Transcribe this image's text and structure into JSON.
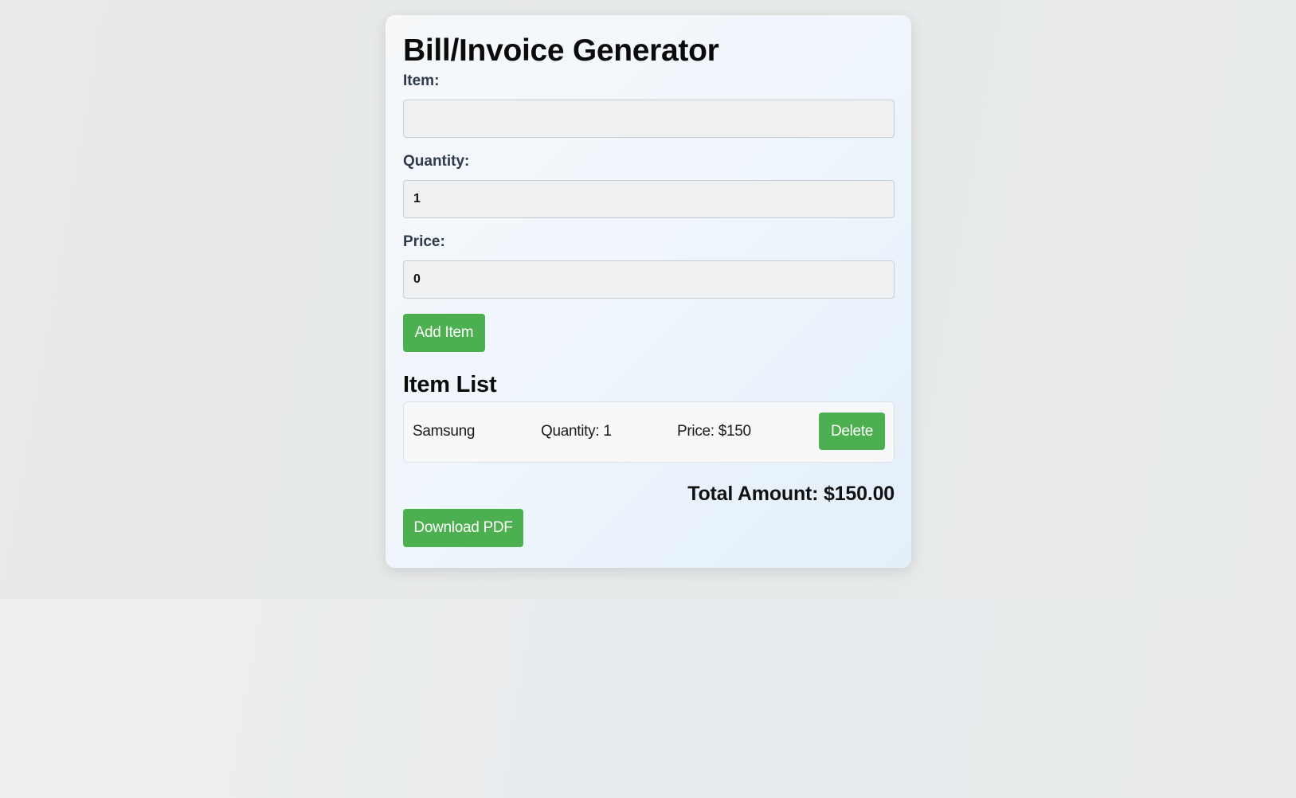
{
  "app": {
    "title": "Bill/Invoice Generator"
  },
  "form": {
    "item_label": "Item:",
    "item_value": "",
    "quantity_label": "Quantity:",
    "quantity_value": "1",
    "price_label": "Price:",
    "price_value": "0",
    "add_button_label": "Add Item"
  },
  "item_list": {
    "title": "Item List",
    "items": [
      {
        "name": "Samsung",
        "quantity_text": "Quantity: 1",
        "price_text": "Price: $150",
        "delete_label": "Delete"
      }
    ]
  },
  "summary": {
    "total_text": "Total Amount: $150.00",
    "download_label": "Download PDF"
  },
  "colors": {
    "accent": "#4caf50",
    "background": "#e8eaeb",
    "card": "#f2f7fc"
  }
}
